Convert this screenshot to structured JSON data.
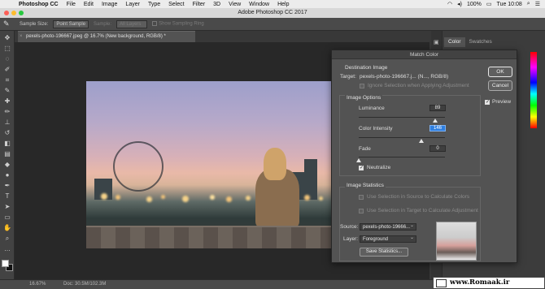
{
  "menubar": {
    "app": "Photoshop CC",
    "items": [
      "File",
      "Edit",
      "Image",
      "Layer",
      "Type",
      "Select",
      "Filter",
      "3D",
      "View",
      "Window",
      "Help"
    ],
    "battery": "100%",
    "clock": "Tue 10:08"
  },
  "window": {
    "title": "Adobe Photoshop CC 2017"
  },
  "options": {
    "sample_size_label": "Sample Size:",
    "sample_size_value": "Point Sample",
    "sample_label": "Sample:",
    "sample_value": "All Layers",
    "show_ring": "Show Sampling Ring"
  },
  "document": {
    "tab": "pexels-photo-196667.jpeg @ 16.7% (New background, RGB/8) *"
  },
  "status": {
    "zoom": "16.67%",
    "doc": "Doc: 30.5M/102.3M"
  },
  "panel": {
    "tabs": [
      "Color",
      "Swatches"
    ]
  },
  "dialog": {
    "title": "Match Color",
    "destination": {
      "heading": "Destination Image",
      "target_label": "Target:",
      "target_value": "pexels-photo-196667.j... (N..., RGB/8)",
      "ignore_selection": "Ignore Selection when Applying Adjustment"
    },
    "options": {
      "heading": "Image Options",
      "luminance_label": "Luminance",
      "luminance_value": "89",
      "luminance_level": 0.89,
      "intensity_label": "Color Intensity",
      "intensity_value": "146",
      "intensity_level": 0.73,
      "fade_label": "Fade",
      "fade_value": "0",
      "fade_level": 0.0,
      "neutralize": "Neutralize"
    },
    "statistics": {
      "heading": "Image Statistics",
      "use_source": "Use Selection in Source to Calculate Colors",
      "use_target": "Use Selection in Target to Calculate Adjustment",
      "source_label": "Source:",
      "source_value": "pexels-photo-19666...",
      "layer_label": "Layer:",
      "layer_value": "Foreground",
      "save_button": "Save Statistics..."
    },
    "ok": "OK",
    "cancel": "Cancel",
    "preview": "Preview"
  },
  "watermark": "www.Romaak.ir"
}
